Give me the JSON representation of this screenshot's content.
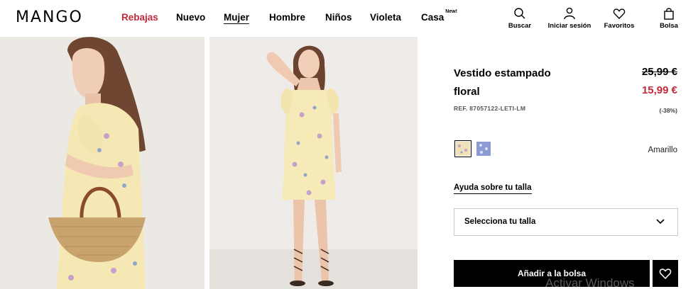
{
  "header": {
    "logo": "MANGO",
    "nav": [
      {
        "label": "Rebajas"
      },
      {
        "label": "Nuevo"
      },
      {
        "label": "Mujer"
      },
      {
        "label": "Hombre"
      },
      {
        "label": "Niños"
      },
      {
        "label": "Violeta"
      },
      {
        "label": "Casa",
        "badge": "New!"
      }
    ],
    "tools": [
      {
        "label": "Buscar",
        "icon": "search-icon"
      },
      {
        "label": "Iniciar sesión",
        "icon": "user-icon"
      },
      {
        "label": "Favoritos",
        "icon": "heart-icon"
      },
      {
        "label": "Bolsa",
        "icon": "bag-icon"
      }
    ]
  },
  "product": {
    "title": "Vestido estampado floral",
    "old_price": "25,99 €",
    "new_price": "15,99 €",
    "ref": "REF. 87057122-LETI-LM",
    "discount": "(-38%)",
    "color_name": "Amarillo",
    "size_guide": "Ayuda sobre tu talla",
    "size_select": "Selecciona tu talla",
    "add_to_bag": "Añadir a la bolsa"
  },
  "colors": {
    "sale_red": "#c6283a",
    "swatch_yellow": "#efe1b8",
    "swatch_blue": "#8b9bd4"
  },
  "watermark": "Activar Windows"
}
